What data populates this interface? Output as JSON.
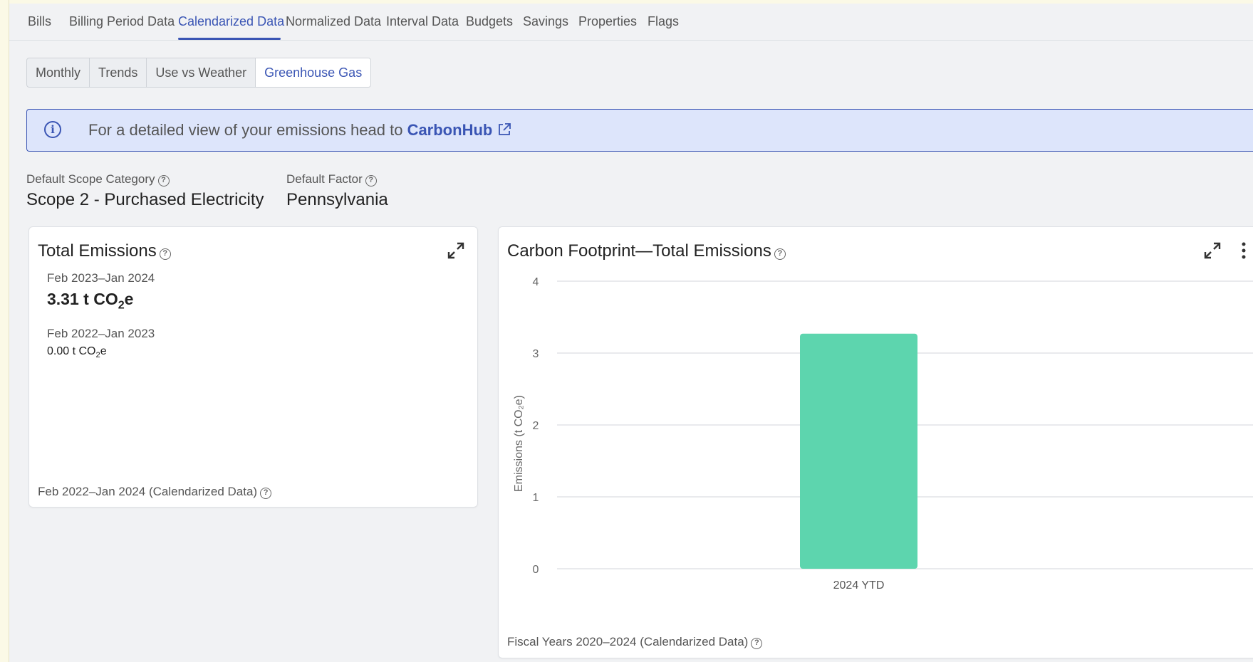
{
  "tabs": [
    {
      "label": "Bills",
      "active": false
    },
    {
      "label": "Billing Period Data",
      "active": false
    },
    {
      "label": "Calendarized Data",
      "active": true
    },
    {
      "label": "Normalized Data",
      "active": false
    },
    {
      "label": "Interval Data",
      "active": false
    },
    {
      "label": "Budgets",
      "active": false
    },
    {
      "label": "Savings",
      "active": false
    },
    {
      "label": "Properties",
      "active": false
    },
    {
      "label": "Flags",
      "active": false
    }
  ],
  "subtabs": [
    {
      "label": "Monthly",
      "active": false
    },
    {
      "label": "Trends",
      "active": false
    },
    {
      "label": "Use vs Weather",
      "active": false
    },
    {
      "label": "Greenhouse Gas",
      "active": true
    }
  ],
  "banner": {
    "text": "For a detailed view of your emissions head to ",
    "link": "CarbonHub"
  },
  "fields": {
    "scope_label": "Default Scope Category",
    "scope_value": "Scope 2 - Purchased Electricity",
    "factor_label": "Default Factor",
    "factor_value": "Pennsylvania"
  },
  "total_card": {
    "title": "Total Emissions",
    "period1": "Feb 2023–Jan 2024",
    "value1": "3.31 t CO",
    "value1_sub": "2",
    "value1_suffix": "e",
    "period2": "Feb 2022–Jan 2023",
    "value2": "0.00 t CO",
    "value2_sub": "2",
    "value2_suffix": "e",
    "footer": "Feb 2022–Jan 2024 (Calendarized Data)"
  },
  "chart_card": {
    "title": "Carbon Footprint—Total Emissions",
    "footer": "Fiscal Years 2020–2024 (Calendarized Data)"
  },
  "chart_data": {
    "type": "bar",
    "title": "Carbon Footprint—Total Emissions",
    "categories": [
      "2024 YTD"
    ],
    "values": [
      3.27
    ],
    "ylabel": "Emissions (t CO₂e)",
    "xlabel": "",
    "ylim": [
      0,
      4
    ],
    "yticks": [
      "0",
      "1",
      "2",
      "3",
      "4"
    ],
    "grid": true,
    "bar_color": "#5dd5ae"
  },
  "colors": {
    "accent": "#3a55b4",
    "banner_bg": "#dde5fb",
    "bar": "#5dd5ae"
  }
}
